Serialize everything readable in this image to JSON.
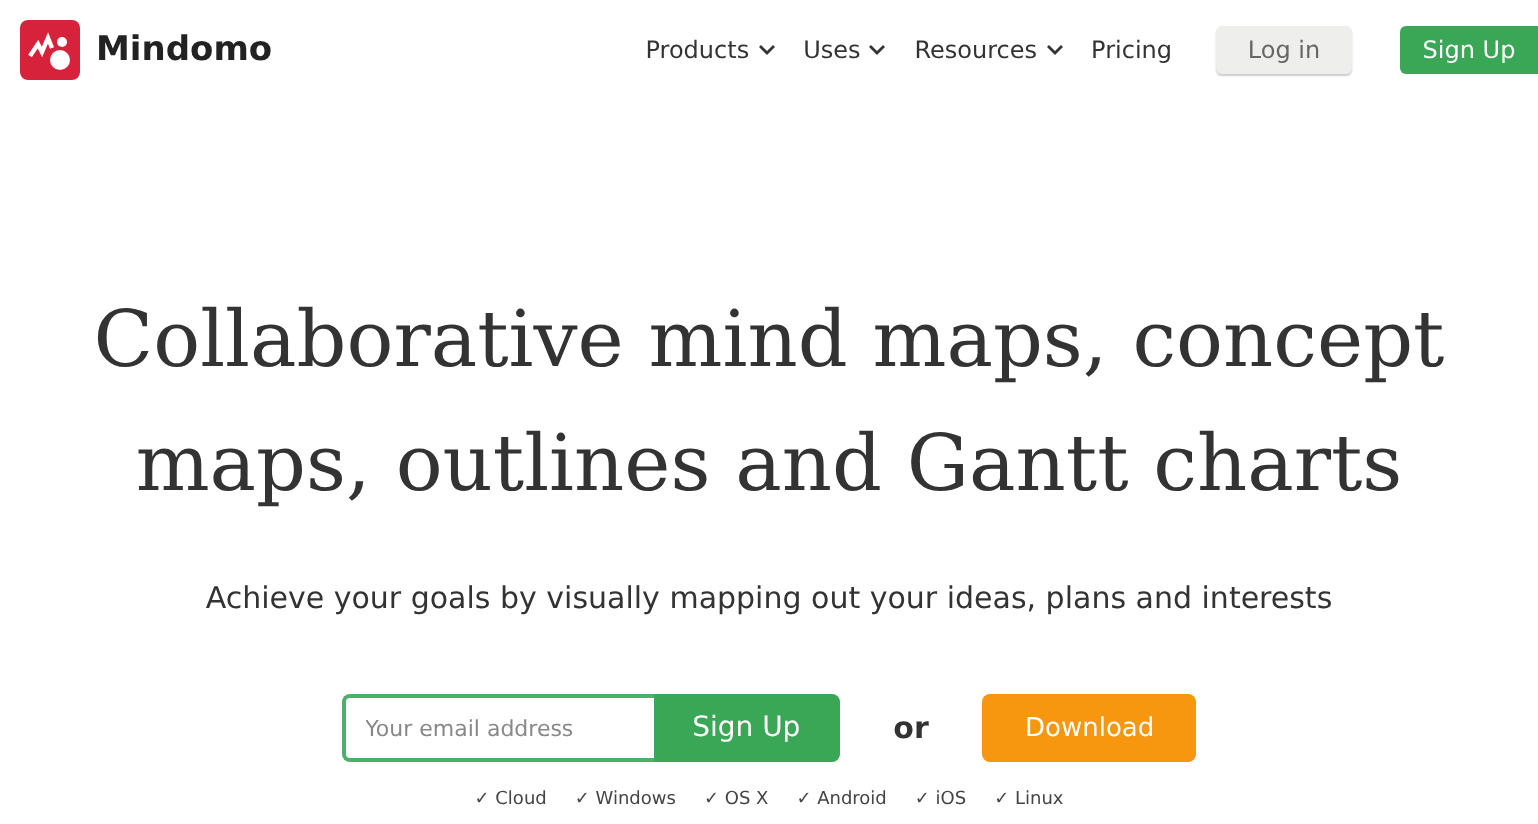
{
  "header": {
    "brand": "Mindomo",
    "nav": [
      {
        "label": "Products",
        "dropdown": true
      },
      {
        "label": "Uses",
        "dropdown": true
      },
      {
        "label": "Resources",
        "dropdown": true
      },
      {
        "label": "Pricing",
        "dropdown": false
      }
    ],
    "login": "Log in",
    "signup": "Sign Up"
  },
  "hero": {
    "headline": "Collaborative mind maps, concept maps, outlines and Gantt charts",
    "subtitle": "Achieve your goals by visually mapping out your ideas, plans and interests",
    "email": {
      "placeholder": "Your email address"
    },
    "signup": "Sign Up",
    "or": "or",
    "download": "Download",
    "platforms": [
      "✓ Cloud",
      "✓ Windows",
      "✓ OS X",
      "✓ Android",
      "✓ iOS",
      "✓ Linux"
    ]
  }
}
